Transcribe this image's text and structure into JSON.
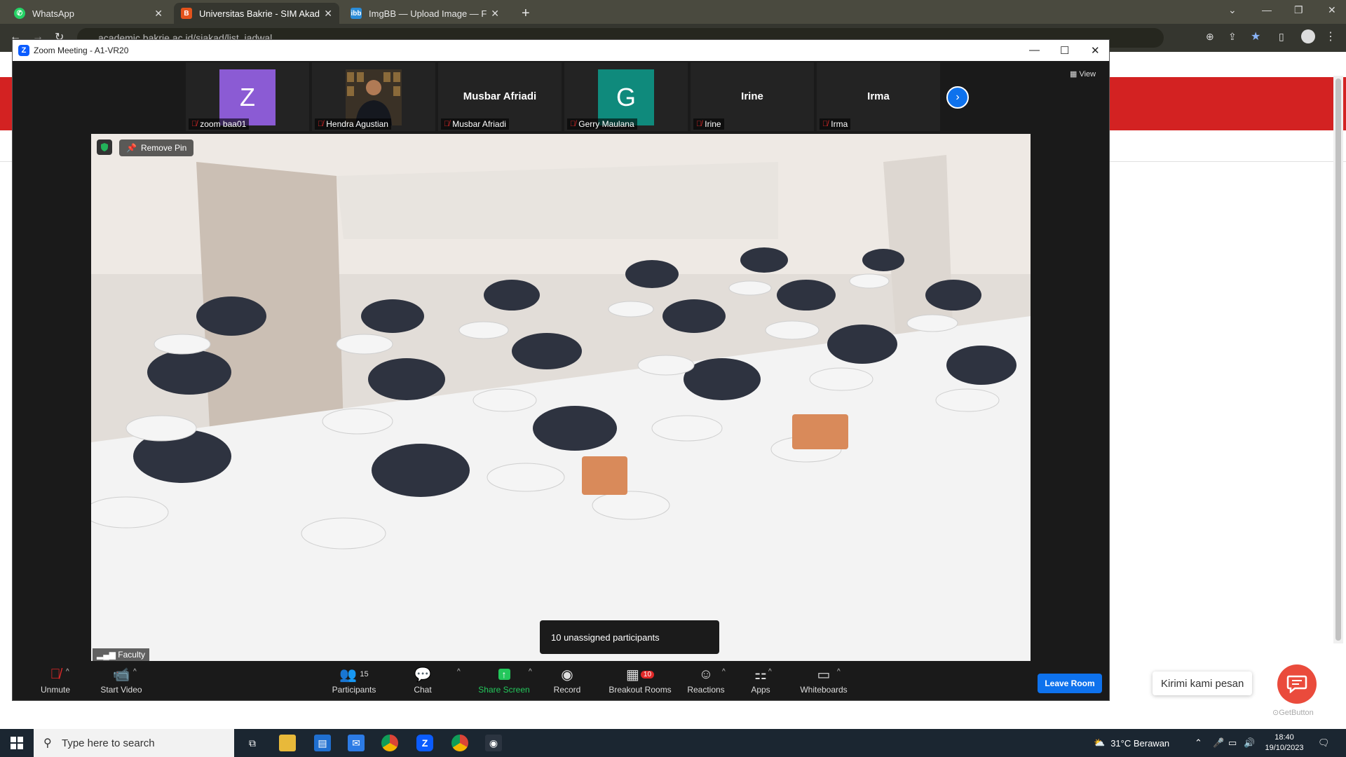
{
  "browser": {
    "tabs": [
      {
        "label": "WhatsApp",
        "icon": "whatsapp-icon",
        "color": "#25d366"
      },
      {
        "label": "Universitas Bakrie - SIM Akadem",
        "icon": "bakrie-icon",
        "color": "#e2531c"
      },
      {
        "label": "ImgBB — Upload Image — Free",
        "icon": "imgbb-icon",
        "color": "#2a8cd8"
      }
    ],
    "url": "academic.bakrie.ac.id/siakad/list_jadwal"
  },
  "zoom": {
    "title": "Zoom Meeting - A1-VR20",
    "view_label": "View",
    "participants": [
      {
        "name": "zoom baa01",
        "avatar_letter": "Z",
        "avatar_color": "#8b5bd4"
      },
      {
        "name": "Hendra Agustian",
        "avatar_letter": "",
        "avatar_color": "#3a3126"
      },
      {
        "name": "Musbar Afriadi",
        "display": "Musbar Afriadi"
      },
      {
        "name": "Gerry Maulana",
        "avatar_letter": "G",
        "avatar_color": "#0f8a7c"
      },
      {
        "name": "Irine",
        "display": "Irine"
      },
      {
        "name": "Irma",
        "display": "Irma"
      }
    ],
    "pinned": {
      "remove_pin_label": "Remove Pin",
      "name": "Faculty"
    },
    "tooltip": "10 unassigned participants",
    "controls": {
      "unmute": "Unmute",
      "start_video": "Start Video",
      "participants": "Participants",
      "participants_count": "15",
      "chat": "Chat",
      "share_screen": "Share Screen",
      "record": "Record",
      "breakout_rooms": "Breakout Rooms",
      "breakout_badge": "10",
      "reactions": "Reactions",
      "apps": "Apps",
      "whiteboards": "Whiteboards",
      "leave_room": "Leave Room"
    }
  },
  "chat_widget": {
    "bubble": "Kirimi kami pesan",
    "brand": "GetButton"
  },
  "taskbar": {
    "search_placeholder": "Type here to search",
    "weather": "31°C  Berawan",
    "time": "18:40",
    "date": "19/10/2023"
  }
}
